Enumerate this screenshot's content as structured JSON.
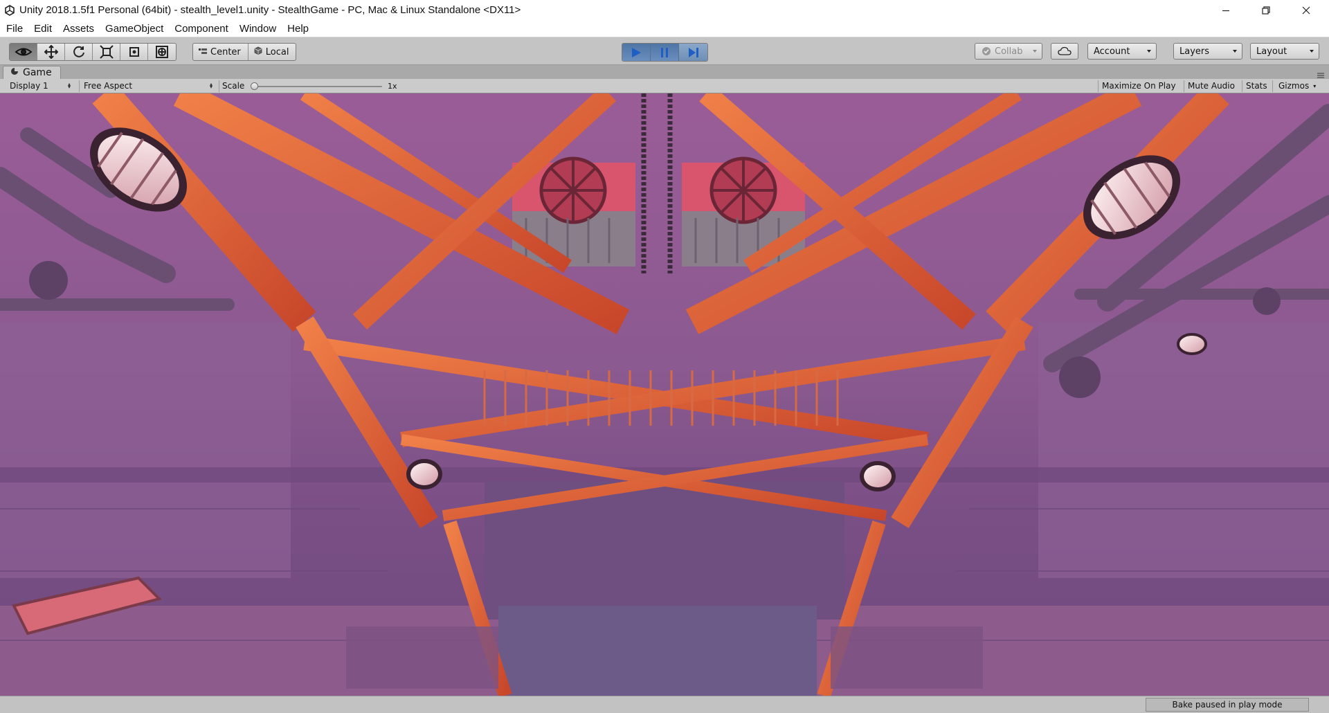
{
  "window": {
    "title": "Unity 2018.1.5f1 Personal (64bit) - stealth_level1.unity - StealthGame - PC, Mac & Linux Standalone <DX11>",
    "controls": [
      "minimize-icon",
      "restore-icon",
      "close-icon"
    ]
  },
  "menu": {
    "items": [
      {
        "label": "File"
      },
      {
        "label": "Edit"
      },
      {
        "label": "Assets"
      },
      {
        "label": "GameObject"
      },
      {
        "label": "Component"
      },
      {
        "label": "Window"
      },
      {
        "label": "Help"
      }
    ]
  },
  "toolbar": {
    "transform_tools": [
      {
        "icon": "hand-eye-icon",
        "active": true
      },
      {
        "icon": "move-icon",
        "active": false
      },
      {
        "icon": "rotate-icon",
        "active": false
      },
      {
        "icon": "scale-icon",
        "active": false
      },
      {
        "icon": "rect-tool-icon",
        "active": false
      },
      {
        "icon": "transform-tool-icon",
        "active": false
      }
    ],
    "pivot_label": "Center",
    "space_label": "Local",
    "play_controls": {
      "play_active": true,
      "pause_active": true,
      "icons": [
        "play-icon",
        "pause-icon",
        "step-icon"
      ]
    },
    "collab_label": "Collab",
    "account_label": "Account",
    "layers_label": "Layers",
    "layout_label": "Layout"
  },
  "game_tab": {
    "label": "Game",
    "display": "Display 1",
    "aspect": "Free Aspect",
    "scale_label": "Scale",
    "scale_value": "1x",
    "scale_level": 0.0,
    "maximize_label": "Maximize On Play",
    "mute_label": "Mute Audio",
    "stats_label": "Stats",
    "gizmos_label": "Gizmos"
  },
  "status": {
    "bake_text": "Bake paused in play mode"
  },
  "colors": {
    "accent_play": "#5b7fb0",
    "scene_girder": "#e8603a",
    "scene_bg": "#8a5a92"
  }
}
